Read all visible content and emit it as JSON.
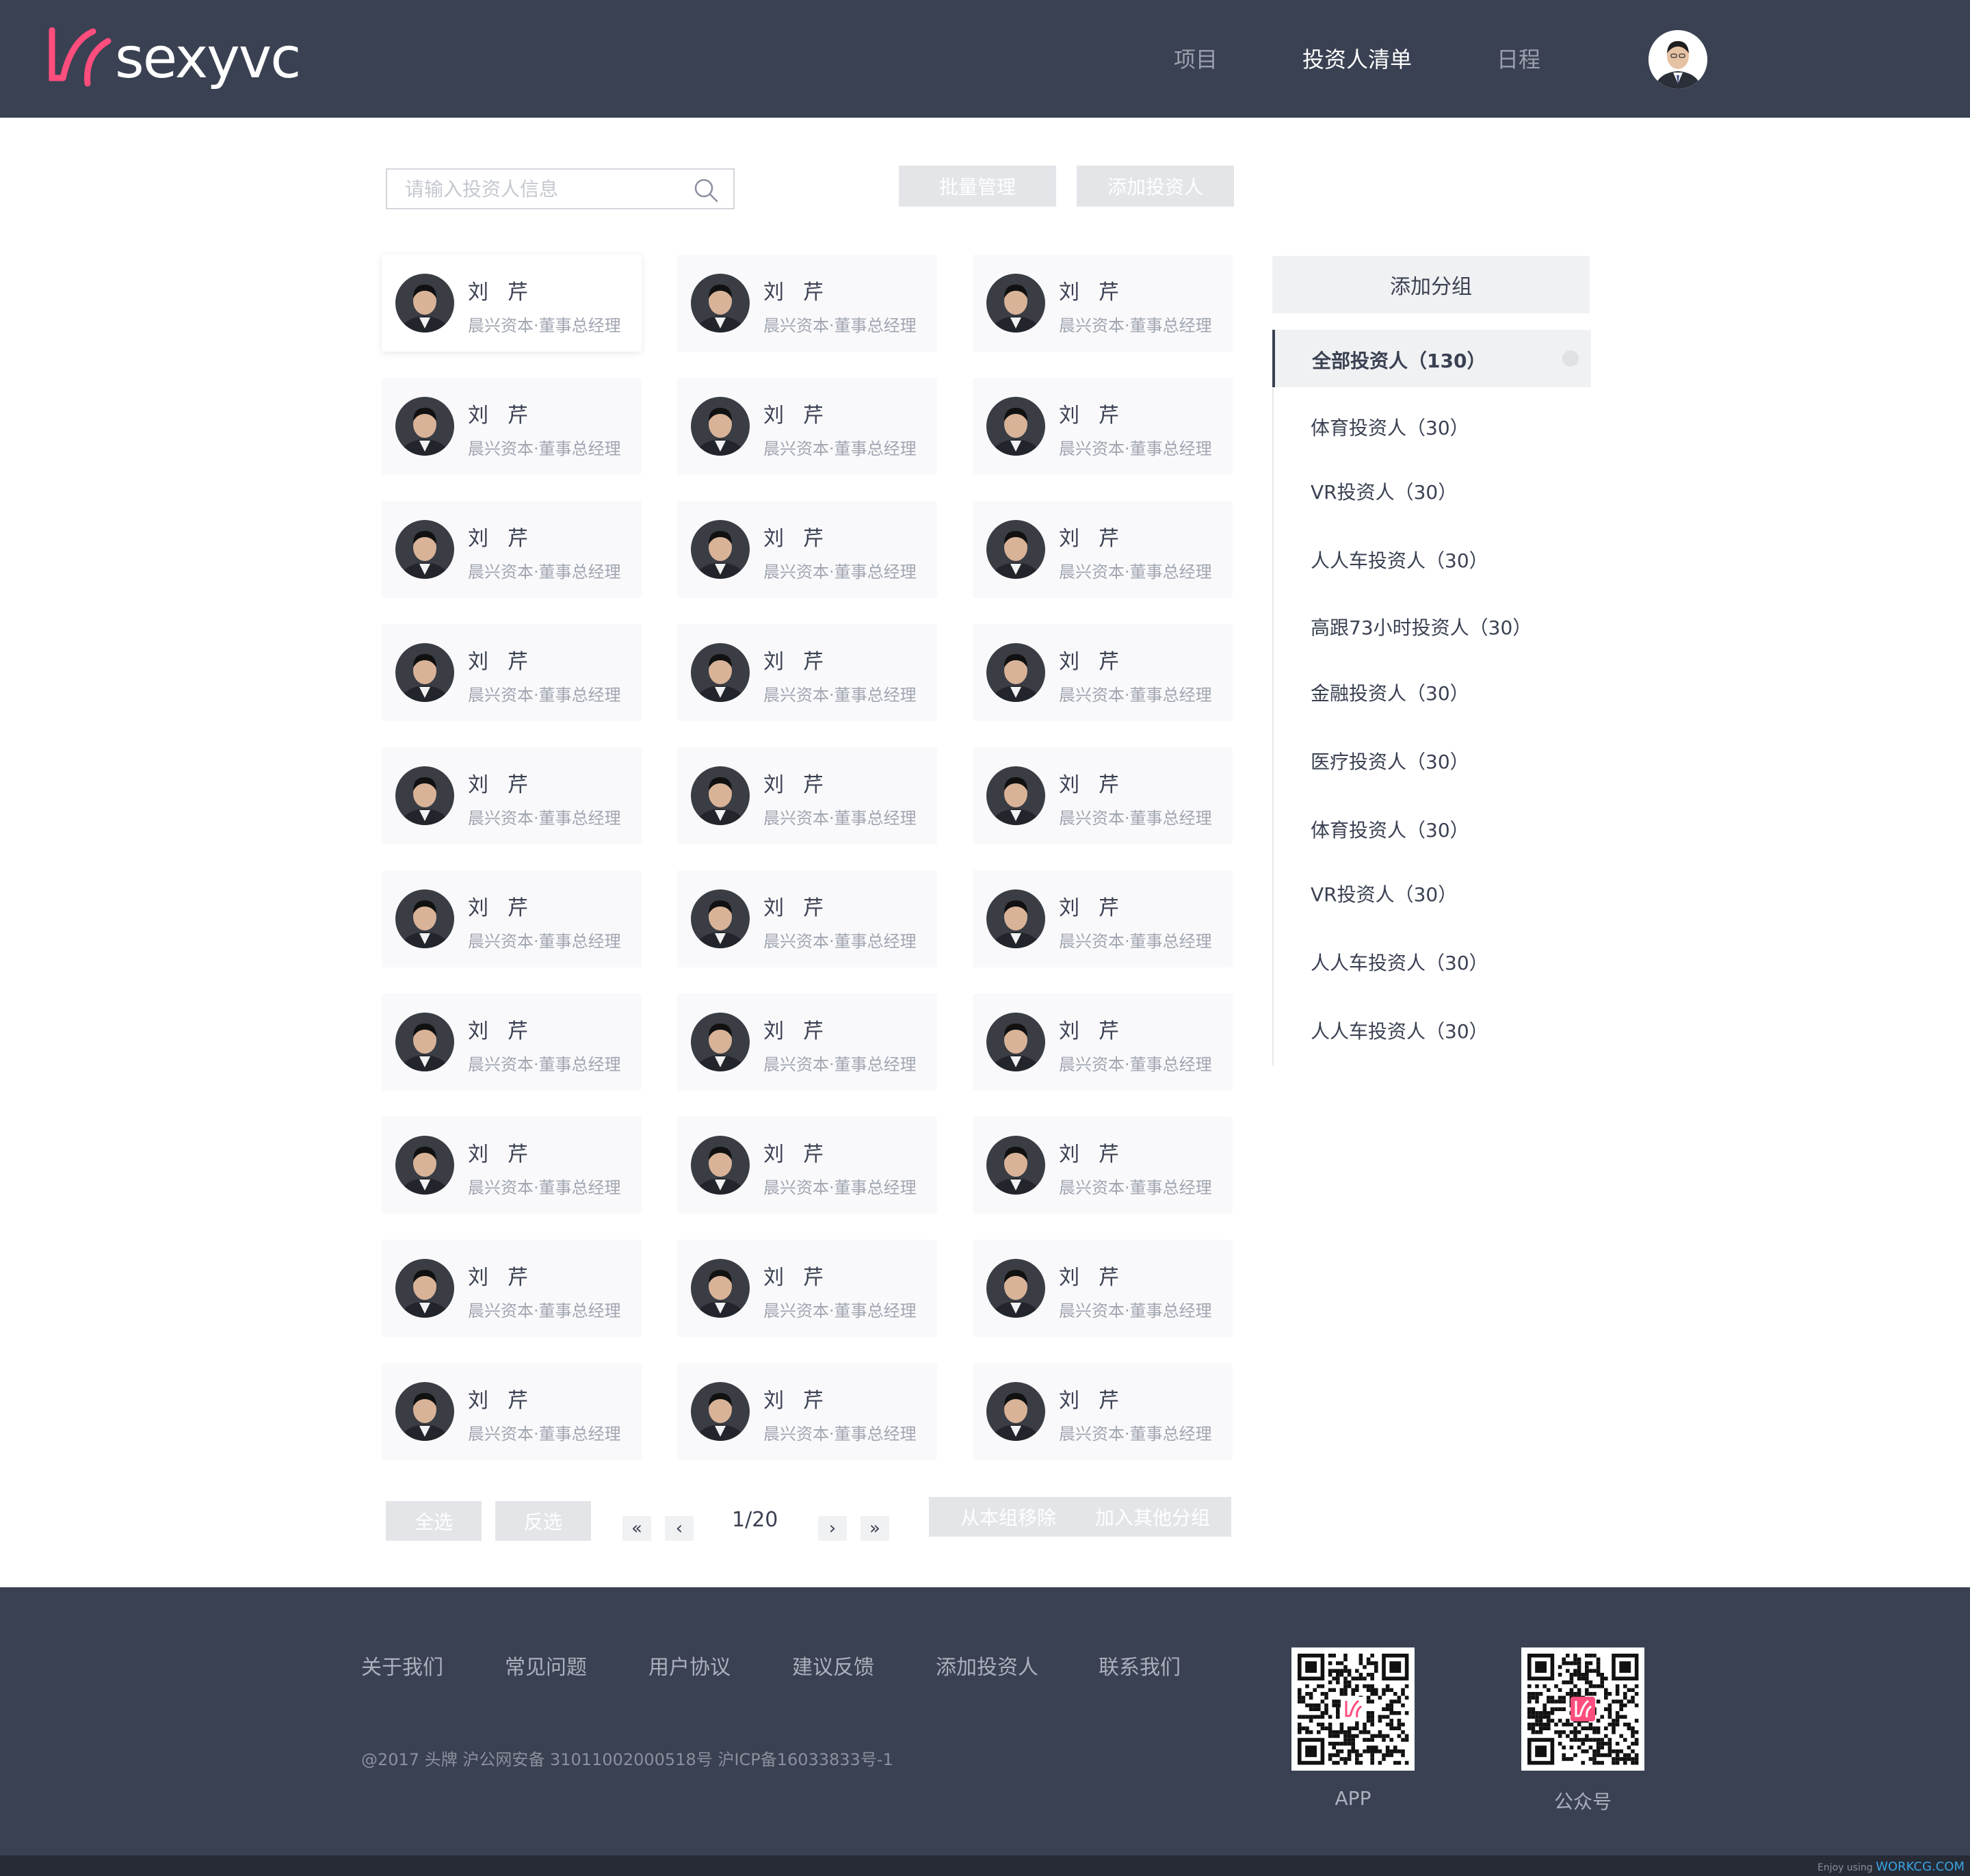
{
  "header": {
    "logo_text": "sexyvc",
    "nav": [
      {
        "label": "项目",
        "active": false
      },
      {
        "label": "投资人清单",
        "active": true
      },
      {
        "label": "日程",
        "active": false
      }
    ]
  },
  "toolbar": {
    "search_placeholder": "请输入投资人信息",
    "batch_label": "批量管理",
    "add_investor_label": "添加投资人"
  },
  "investor": {
    "name": "刘芹",
    "title": "晨兴资本·董事总经理"
  },
  "sidebar": {
    "add_group_label": "添加分组",
    "groups": [
      {
        "label": "全部投资人（130）",
        "active": true
      },
      {
        "label": "体育投资人（30）",
        "active": false
      },
      {
        "label": "VR投资人（30）",
        "active": false
      },
      {
        "label": "人人车投资人（30）",
        "active": false
      },
      {
        "label": "高跟73小时投资人（30）",
        "active": false
      },
      {
        "label": "金融投资人（30）",
        "active": false
      },
      {
        "label": "医疗投资人（30）",
        "active": false
      },
      {
        "label": "体育投资人（30）",
        "active": false
      },
      {
        "label": "VR投资人（30）",
        "active": false
      },
      {
        "label": "人人车投资人（30）",
        "active": false
      },
      {
        "label": "人人车投资人（30）",
        "active": false
      }
    ]
  },
  "pagination": {
    "select_all_label": "全选",
    "invert_label": "反选",
    "first_glyph": "«",
    "prev_glyph": "‹",
    "next_glyph": "›",
    "last_glyph": "»",
    "page_text": "1/20",
    "remove_label": "从本组移除",
    "add_other_label": "加入其他分组"
  },
  "footer": {
    "links": [
      "关于我们",
      "常见问题",
      "用户协议",
      "建议反馈",
      "添加投资人",
      "联系我们"
    ],
    "copyright": "@2017 头牌  沪公网安备 31011002000518号 沪ICP备16033833号-1",
    "qr_app_label": "APP",
    "qr_wechat_label": "公众号",
    "credit_prefix": "Enjoy using",
    "credit_site": "WORKCG.COM"
  },
  "colors": {
    "header_bg": "#3a4152",
    "brand_pink": "#ff4d7d",
    "button_gray": "#e3e5e9"
  }
}
